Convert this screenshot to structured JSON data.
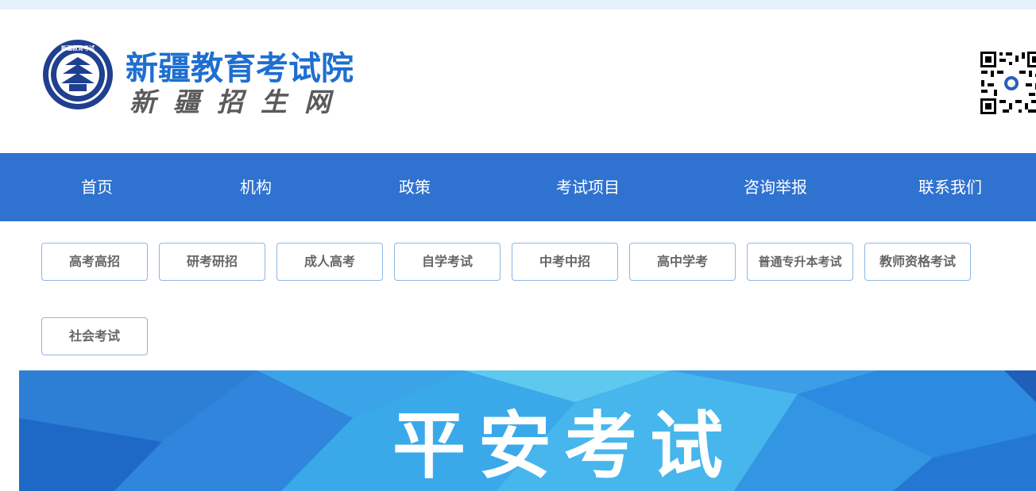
{
  "header": {
    "title": "新疆教育考试院",
    "subtitle": "新疆招生网",
    "emblem_text": "新疆教育考试院",
    "brand_color": "#1e6fd0"
  },
  "nav": {
    "items": [
      {
        "label": "首页"
      },
      {
        "label": "机构"
      },
      {
        "label": "政策"
      },
      {
        "label": "考试项目"
      },
      {
        "label": "咨询举报"
      },
      {
        "label": "联系我们"
      }
    ],
    "background": "#2f72d0"
  },
  "categories": [
    {
      "label": "高考高招"
    },
    {
      "label": "研考研招"
    },
    {
      "label": "成人高考"
    },
    {
      "label": "自学考试"
    },
    {
      "label": "中考中招"
    },
    {
      "label": "高中学考"
    },
    {
      "label": "普通专升本考试"
    },
    {
      "label": "教师资格考试"
    },
    {
      "label": "社会考试"
    }
  ],
  "banner": {
    "title": "平安考试"
  }
}
